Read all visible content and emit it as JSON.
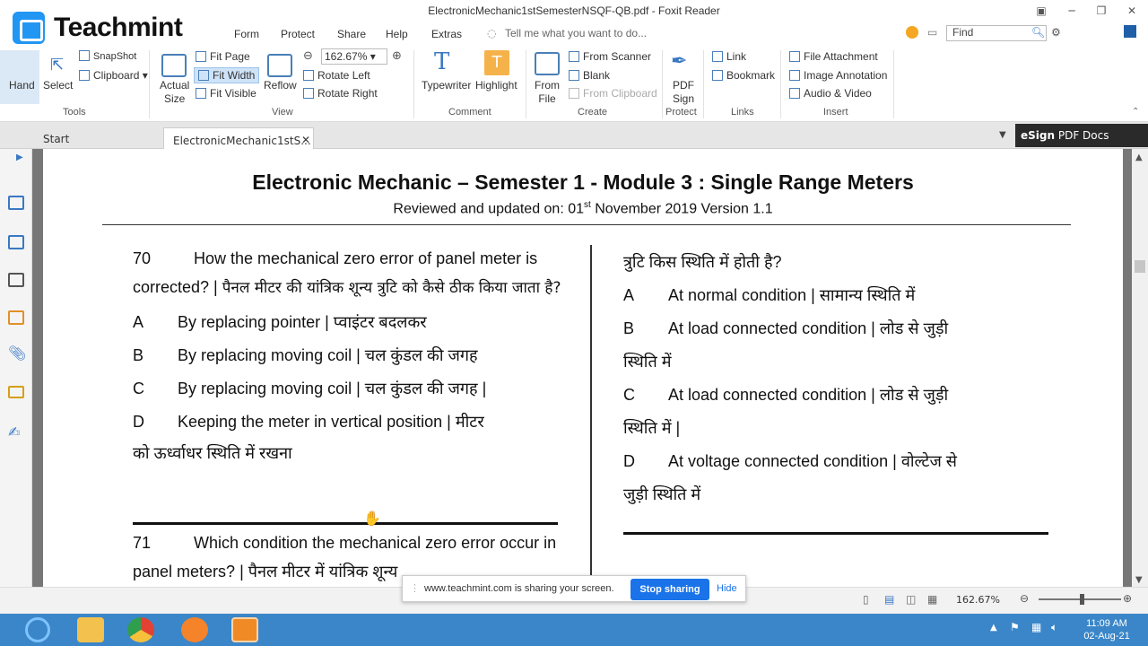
{
  "window": {
    "title": "ElectronicMechanic1stSemesterNSQF-QB.pdf - Foxit Reader"
  },
  "brand": {
    "logo_text": "Teachmint"
  },
  "menu": {
    "items": [
      "Form",
      "Protect",
      "Share",
      "Help",
      "Extras"
    ],
    "tell_me": "Tell me what you want to do...",
    "find_placeholder": "Find"
  },
  "ribbon": {
    "hand": "Hand",
    "select": "Select",
    "snapshot": "SnapShot",
    "clipboard": "Clipboard",
    "actual_size": "Actual\nSize",
    "fit_page": "Fit Page",
    "fit_width": "Fit Width",
    "fit_visible": "Fit Visible",
    "reflow": "Reflow",
    "zoom_value": "162.67%",
    "rotate_left": "Rotate Left",
    "rotate_right": "Rotate Right",
    "typewriter": "Typewriter",
    "highlight": "Highlight",
    "from_file": "From\nFile",
    "from_scanner": "From Scanner",
    "blank": "Blank",
    "from_clipboard": "From Clipboard",
    "pdf_sign": "PDF\nSign",
    "link": "Link",
    "bookmark": "Bookmark",
    "file_attachment": "File Attachment",
    "image_annotation": "Image Annotation",
    "audio_video": "Audio & Video",
    "groups": {
      "tools": "Tools",
      "view": "View",
      "comment": "Comment",
      "create": "Create",
      "protect": "Protect",
      "links": "Links",
      "insert": "Insert"
    }
  },
  "tabs": {
    "start": "Start",
    "document": "ElectronicMechanic1stS..."
  },
  "esign": {
    "brand": "eSign",
    "label": "PDF Docs"
  },
  "pdf": {
    "title": "Electronic Mechanic – Semester 1 - Module 3 : Single Range Meters",
    "subtitle_pre": "Reviewed and updated on: 01",
    "subtitle_sup": "st",
    "subtitle_post": " November 2019 Version 1.1",
    "q70": {
      "number": "70",
      "text_en": "How the mechanical zero error of panel meter is corrected? |",
      "text_hi": "पैनल मीटर की यांत्रिक शून्य त्रुटि को कैसे ठीक किया जाता है?",
      "options": [
        {
          "letter": "A",
          "text": "By replacing pointer | प्वाइंटर बदलकर"
        },
        {
          "letter": "B",
          "text": "By replacing moving coil | चल कुंडल की जगह"
        },
        {
          "letter": "C",
          "text": "By replacing moving coil | चल कुंडल की जगह |"
        },
        {
          "letter": "D",
          "text": "Keeping the meter in vertical position | मीटर",
          "cont": "को ऊर्ध्वाधर स्थिति में रखना"
        }
      ]
    },
    "q71": {
      "number": "71",
      "text_en": "Which condition the mechanical zero error occur in panel meters? | पैनल मीटर में यांत्रिक शून्य"
    },
    "right": {
      "cont": "त्रुटि किस स्थिति में होती है?",
      "options": [
        {
          "letter": "A",
          "text": "At normal condition | सामान्य स्थिति में"
        },
        {
          "letter": "B",
          "text": "At load connected condition | लोड से जुड़ी",
          "cont": "स्थिति में"
        },
        {
          "letter": "C",
          "text": "At load connected condition | लोड से जुड़ी",
          "cont": "स्थिति में |"
        },
        {
          "letter": "D",
          "text": "At voltage connected condition | वोल्टेज से",
          "cont": "जुड़ी स्थिति में"
        }
      ]
    }
  },
  "status": {
    "zoom": "162.67%"
  },
  "share": {
    "message": "www.teachmint.com is sharing your screen.",
    "stop": "Stop sharing",
    "hide": "Hide"
  },
  "clock": {
    "time": "11:09 AM",
    "date": "02-Aug-21"
  }
}
